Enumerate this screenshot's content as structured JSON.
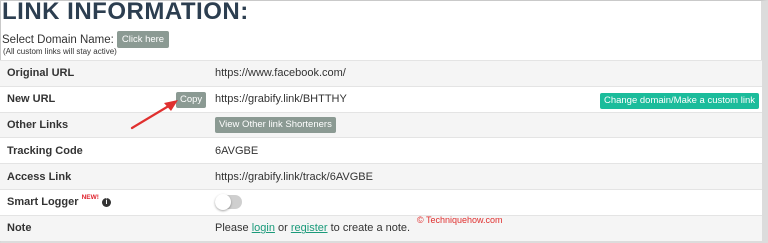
{
  "header": {
    "title": "LINK INFORMATION:",
    "domain_prompt": "Select Domain Name:",
    "click_here_label": "Click here",
    "custom_links_note": "(All custom links will stay active)"
  },
  "rows": {
    "original_url": {
      "label": "Original URL",
      "value": "https://www.facebook.com/"
    },
    "new_url": {
      "label": "New URL",
      "copy_label": "Copy",
      "value": "https://grabify.link/BHTTHY",
      "change_domain_label": "Change domain/Make a custom link"
    },
    "other_links": {
      "label": "Other Links",
      "button_label": "View Other link Shorteners"
    },
    "tracking_code": {
      "label": "Tracking Code",
      "value": "6AVGBE"
    },
    "access_link": {
      "label": "Access Link",
      "value": "https://grabify.link/track/6AVGBE"
    },
    "smart_logger": {
      "label": "Smart Logger",
      "badge": "NEW!",
      "info_icon": "info-circle-icon",
      "enabled": false
    },
    "note": {
      "label": "Note",
      "text_before": "Please ",
      "login_label": "login",
      "text_middle": " or ",
      "register_label": "register",
      "text_after": " to create a note."
    }
  },
  "watermark": {
    "text": "© Techniquehow.com"
  },
  "colors": {
    "title": "#2c3e50",
    "grey_button": "#8b9a93",
    "green_button": "#1bbc9b",
    "link": "#1a9a7a",
    "badge": "#e0242f",
    "arrow": "#e0302f"
  }
}
